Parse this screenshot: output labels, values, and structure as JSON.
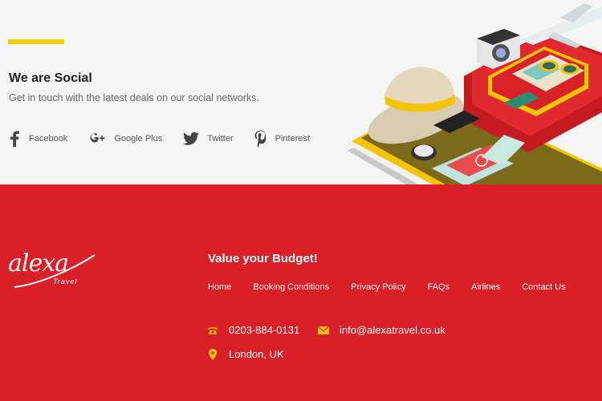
{
  "social": {
    "title": "We are Social",
    "subtitle": "Get in touch with the latest deals on our social networks.",
    "links": [
      {
        "label": "Facebook",
        "icon": "facebook-icon"
      },
      {
        "label": "Google Plus",
        "icon": "google-plus-icon"
      },
      {
        "label": "Twitter",
        "icon": "twitter-icon"
      },
      {
        "label": "Pinterest",
        "icon": "pinterest-icon"
      }
    ]
  },
  "footer": {
    "logo": {
      "word": "alexa",
      "sub": "Travel"
    },
    "tagline": "Value your Budget!",
    "nav": [
      "Home",
      "Booking Conditions",
      "Privacy Policy",
      "FAQs",
      "Airlines",
      "Contact Us"
    ],
    "phone": "0203-884-0131",
    "email": "info@alexatravel.co.uk",
    "address": "London, UK"
  },
  "colors": {
    "accent": "#f5d000",
    "footer_bg": "#d91f27",
    "page_bg": "#f5f5f5"
  }
}
